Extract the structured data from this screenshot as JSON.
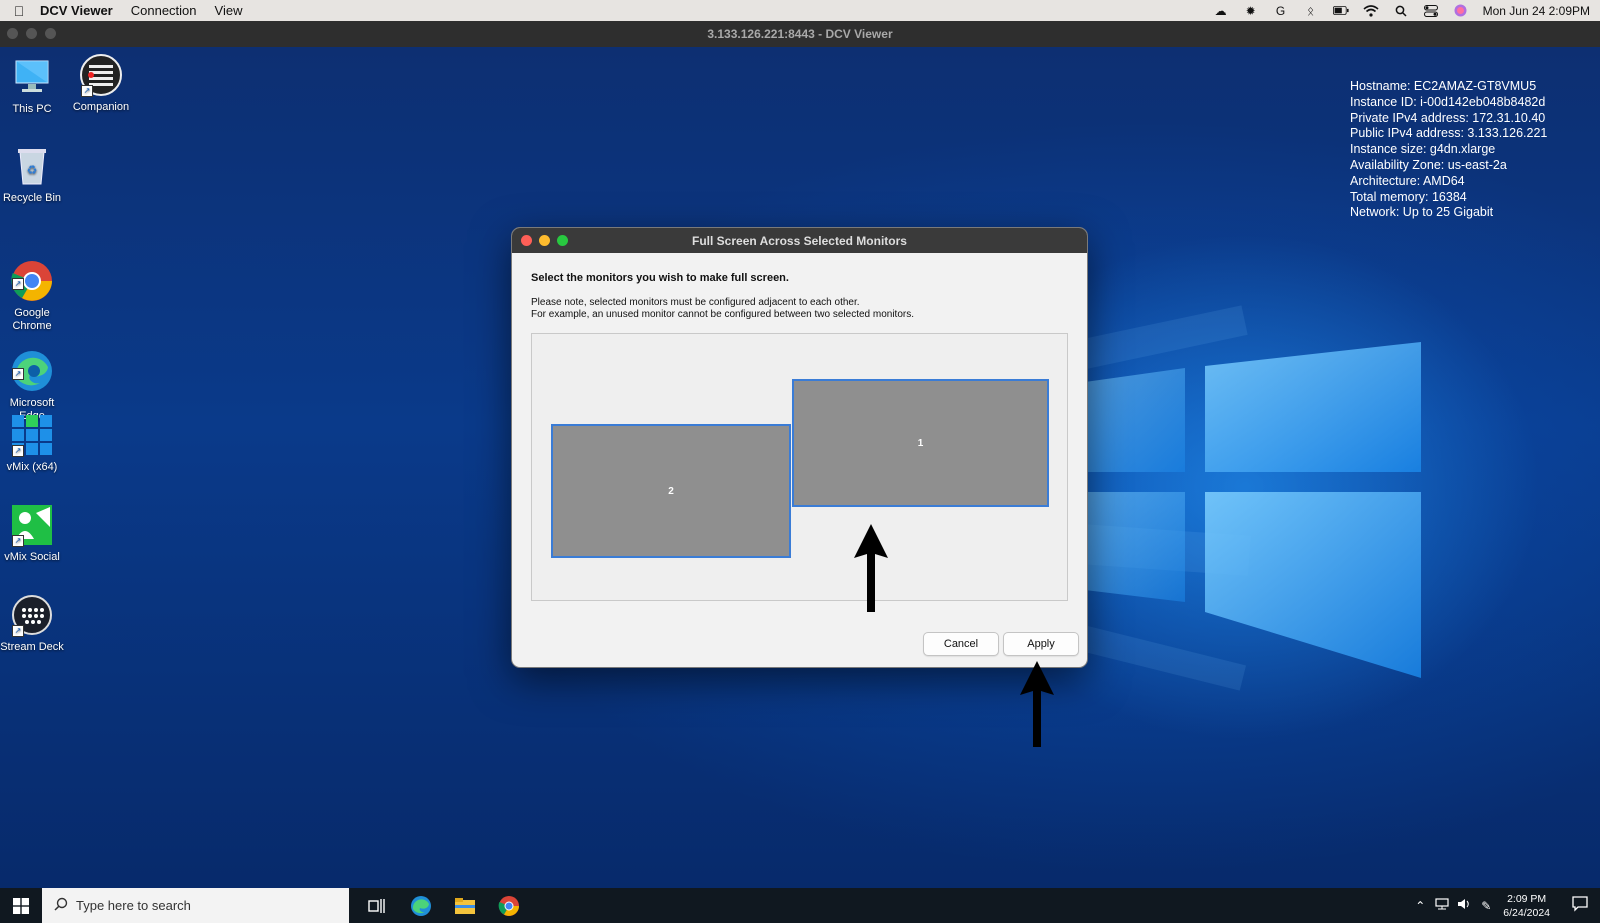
{
  "mac_menubar": {
    "app_name": "DCV Viewer",
    "menus": [
      "Connection",
      "View"
    ],
    "datetime": "Mon Jun 24  2:09PM"
  },
  "window": {
    "title": "3.133.126.221:8443 - DCV Viewer"
  },
  "desktop": {
    "icons": [
      {
        "label": "This PC",
        "icon": "this-pc-icon"
      },
      {
        "label": "Companion",
        "icon": "companion-icon"
      },
      {
        "label": "Recycle Bin",
        "icon": "recycle-bin-icon"
      },
      {
        "label": "Google\nChrome",
        "icon": "chrome-icon"
      },
      {
        "label": "Microsoft\nEdge",
        "icon": "edge-icon"
      },
      {
        "label": "vMix (x64)",
        "icon": "vmix-icon"
      },
      {
        "label": "vMix Social",
        "icon": "vmix-social-icon"
      },
      {
        "label": "Stream Deck",
        "icon": "stream-deck-icon"
      }
    ],
    "sysinfo": [
      "Hostname: EC2AMAZ-GT8VMU5",
      "Instance ID: i-00d142eb048b8482d",
      "Private IPv4 address: 172.31.10.40",
      "Public IPv4 address: 3.133.126.221",
      "Instance size: g4dn.xlarge",
      "Availability Zone: us-east-2a",
      "Architecture: AMD64",
      "Total memory: 16384",
      "Network: Up to 25 Gigabit"
    ]
  },
  "dialog": {
    "title": "Full Screen Across Selected Monitors",
    "heading": "Select the monitors you wish to make full screen.",
    "note_line1": "Please note, selected monitors must be configured adjacent to each other.",
    "note_line2": "For example, an unused monitor cannot be configured between two selected monitors.",
    "monitors": [
      {
        "label": "2"
      },
      {
        "label": "1"
      }
    ],
    "cancel_label": "Cancel",
    "apply_label": "Apply",
    "accent_color": "#3a7cd6"
  },
  "taskbar": {
    "search_placeholder": "Type here to search",
    "time": "2:09 PM",
    "date": "6/24/2024"
  }
}
